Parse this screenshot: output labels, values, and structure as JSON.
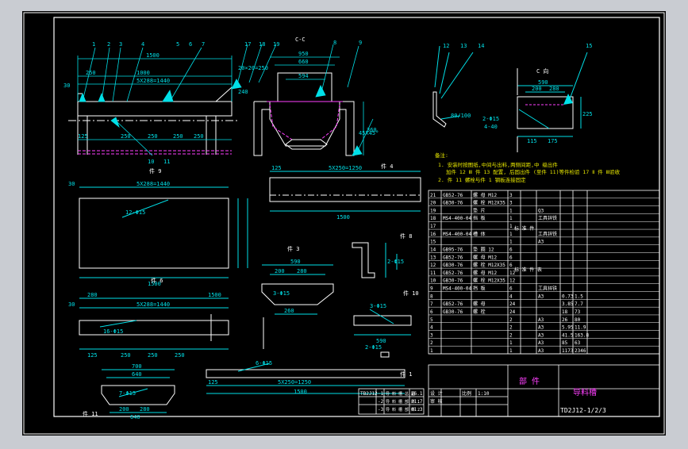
{
  "drawing": {
    "section_label": "C-C",
    "view_c_label": "C 向",
    "part_title": "部 件",
    "product_name": "导料槽",
    "drawing_no": "TD2J12-1/2/3",
    "view_labels": [
      "件 9",
      "件 4",
      "件 3",
      "件 8",
      "件 6",
      "件 10",
      "件 2",
      "件 1",
      "件 11"
    ],
    "callouts": [
      "1",
      "2",
      "3",
      "4",
      "5",
      "6",
      "7",
      "17",
      "18",
      "19",
      "8",
      "9",
      "12",
      "13",
      "14",
      "15",
      "16",
      "10",
      "11"
    ],
    "notes": {
      "title": "备注:",
      "line1": "1. 安装时按图纸,中间与出料,两侧间距,中 级出件",
      "line2": "加件 12 Ⅲ 件 13 配置, 后固出件 (至件 11)等件检验 17 Ⅱ 件 Ⅲ验收",
      "line3": "2. 件 11 螺栓与件 1 钢板连接固定"
    }
  },
  "dims": {
    "d_950": "950",
    "d_660": "660",
    "d_594": "594",
    "d_1500": "1500",
    "d_1000": "1000",
    "d_250": "250",
    "d_20_250": "20×20=250",
    "d_5x288": "5X288=1440",
    "d_125": "125",
    "d_50": "50",
    "d_30": "30",
    "d_240": "240",
    "d_45": "45X45°",
    "d_5x250": "5X250=1250",
    "d_12d15": "12-Φ15",
    "d_590": "590",
    "d_280": "280",
    "d_200": "200",
    "d_3d15": "3-Φ15",
    "d_260": "260",
    "d_16d15": "16-Φ15",
    "d_700": "700",
    "d_640": "640",
    "d_7d15": "7-Φ15",
    "d_6d15": "6-Φ15",
    "d_2d15": "2-Φ15",
    "d_4d40": "4-40",
    "d_3d15b": "3-Φ15",
    "d_80_100": "80/100",
    "d_360": "360",
    "d_115": "115",
    "d_225": "225",
    "d_175": "175"
  },
  "bom": {
    "rows": [
      [
        "21",
        "GB52-76",
        "螺 母 M12",
        "3",
        "",
        "",
        "",
        ""
      ],
      [
        "20",
        "GB30-76",
        "螺 栓 M12X35",
        "3",
        "",
        "",
        "",
        ""
      ],
      [
        "19",
        "",
        "垫 片",
        "1",
        "",
        "Q3",
        "",
        ""
      ],
      [
        "18",
        "MS4-400-04",
        "挡 板",
        "1",
        "",
        "工具锌铁",
        "",
        ""
      ],
      [
        "17",
        "",
        "",
        "1",
        "",
        "",
        "",
        ""
      ],
      [
        "16",
        "MS4-400-04",
        "槽 体",
        "1",
        "",
        "工具锌铁",
        "",
        ""
      ],
      [
        "15",
        "",
        "",
        "1",
        "",
        "A3",
        "",
        ""
      ],
      [
        "14",
        "GB95-76",
        "垫 圈 12",
        "6",
        "",
        "",
        "",
        ""
      ],
      [
        "13",
        "GB52-76",
        "螺 母 M12",
        "6",
        "",
        "",
        "",
        ""
      ],
      [
        "12",
        "GB30-76",
        "螺 栓 M12X35",
        "6",
        "",
        "",
        "",
        ""
      ],
      [
        "11",
        "GB52-76",
        "螺 母 M12",
        "12",
        "",
        "",
        "",
        ""
      ],
      [
        "10",
        "GB30-76",
        "螺 栓 M12X35",
        "12",
        "",
        "",
        "",
        ""
      ],
      [
        "9",
        "MS4-400-04",
        "挡 板",
        "6",
        "",
        "工具锌铁",
        "",
        ""
      ],
      [
        "8",
        "",
        "",
        "4",
        "",
        "A3",
        "0.73",
        "1.5"
      ],
      [
        "7",
        "GB52-76",
        "螺 母",
        "24",
        "",
        "",
        "3.85",
        "7.7"
      ],
      [
        "6",
        "GB30-76",
        "螺 栓",
        "24",
        "",
        "",
        "18",
        "73"
      ],
      [
        "5",
        "",
        "",
        "2",
        "",
        "A3",
        "26",
        "80"
      ],
      [
        "4",
        "",
        "",
        "2",
        "",
        "A3",
        "5.95",
        "11.9"
      ],
      [
        "3",
        "",
        "",
        "2",
        "",
        "A3",
        "41.5",
        "163.8"
      ],
      [
        "2",
        "",
        "",
        "1",
        "",
        "A3",
        "85",
        "63"
      ],
      [
        "1",
        "",
        "",
        "1",
        "",
        "A3",
        "1173",
        "2346"
      ]
    ],
    "section_headers": [
      "标 准 件",
      "标 准 件 表"
    ]
  },
  "titleblock": {
    "designer_label": "设 计",
    "checker_label": "审 核",
    "scale_label": "比例",
    "scale_value": "1:10"
  },
  "ref_table": {
    "rows": [
      [
        "TB2J12",
        "-1",
        "导 料 槽 总 图",
        "26.1"
      ],
      [
        "",
        "-2",
        "导 料 槽 部 件 1",
        "21.7"
      ],
      [
        "",
        "-3",
        "导 料 槽 部 件 2",
        "81.3"
      ]
    ]
  },
  "colors": {
    "frame_bg": "#000000",
    "outer_bg": "#c9ccd2",
    "line_white": "#ffffff",
    "line_cyan": "#00e0e8",
    "line_magenta": "#ff40ff",
    "line_yellow": "#e8e800",
    "line_green": "#40ff40"
  }
}
